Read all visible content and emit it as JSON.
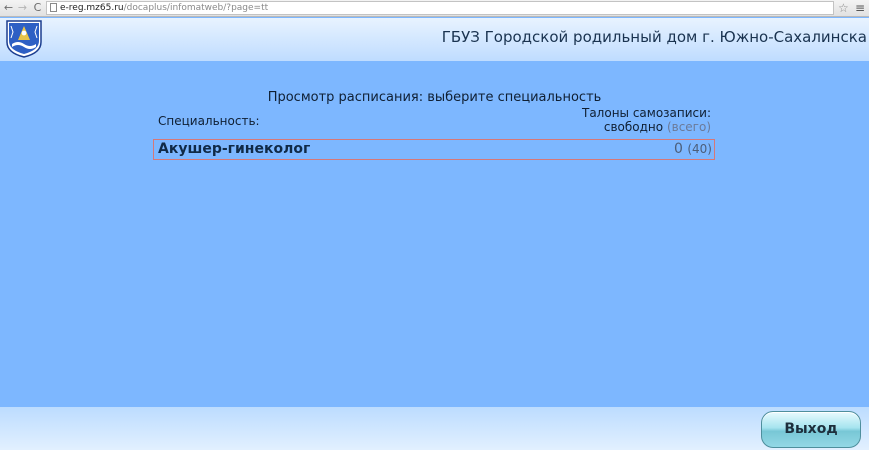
{
  "browser": {
    "url_domain": "e-reg.mz65.ru",
    "url_path": "/docaplus/infomatweb/?page=tt",
    "back_glyph": "←",
    "forward_glyph": "→",
    "reload_glyph": "C",
    "star_glyph": "☆",
    "menu_glyph": "≡"
  },
  "header": {
    "title": "ГБУЗ Городской родильный дом г. Южно-Сахалинска",
    "logo_icon": "sakhalin-coat-of-arms-icon"
  },
  "main": {
    "page_title": "Просмотр расписания: выберите специальность",
    "columns": {
      "specialty": "Специальность:",
      "tickets_line1": "Талоны самозаписи:",
      "tickets_free": "свободно",
      "tickets_total_label": "(всего)"
    },
    "specialties": [
      {
        "name": "Акушер-гинеколог",
        "free": "0",
        "total": "(40)"
      }
    ]
  },
  "footer": {
    "exit_label": "Выход"
  },
  "colors": {
    "background": "#7db7ff",
    "row_border": "#d67878",
    "exit_button": "#93d8e5"
  }
}
